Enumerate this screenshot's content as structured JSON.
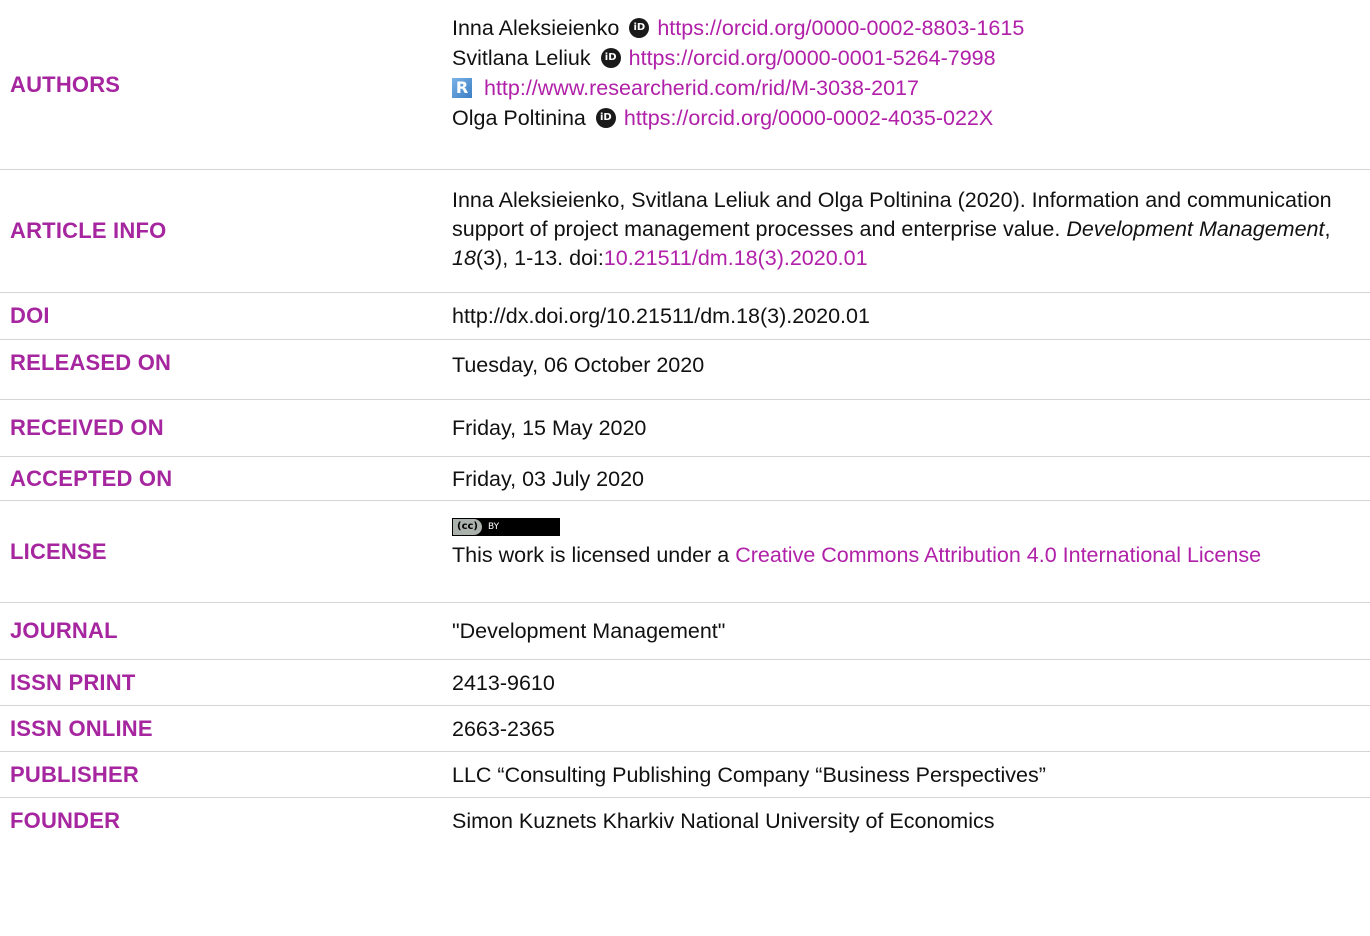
{
  "authors": {
    "label": "AUTHORS",
    "lines": [
      {
        "name": "Inna Aleksieienko",
        "link": "https://orcid.org/0000-0002-8803-1615"
      },
      {
        "name": "Svitlana Leliuk",
        "link": "https://orcid.org/0000-0001-5264-7998"
      },
      {
        "name": "",
        "link": "http://www.researcherid.com/rid/M-3038-2017"
      },
      {
        "name": "Olga Poltinina",
        "link": "https://orcid.org/0000-0002-4035-022X"
      }
    ]
  },
  "article_info": {
    "label": "ARTICLE INFO",
    "text1": "Inna Aleksieienko, Svitlana Leliuk and Olga Poltinina (2020). Information and communication support of project management processes and enterprise value.",
    "journal": "Development Management",
    "sep1": ", ",
    "volume": "18",
    "issue_pages": "(3), 1-13. doi:",
    "doi_link": "10.21511/dm.18(3).2020.01"
  },
  "doi": {
    "label": "DOI",
    "value": "http://dx.doi.org/10.21511/dm.18(3).2020.01"
  },
  "released_on": {
    "label": "RELEASED ON",
    "value": "Tuesday, 06 October 2020"
  },
  "received_on": {
    "label": "RECEIVED ON",
    "value": "Friday, 15 May 2020"
  },
  "accepted_on": {
    "label": "ACCEPTED ON",
    "value": "Friday, 03 July 2020"
  },
  "license": {
    "label": "LICENSE",
    "badge_cc": "(cc)",
    "badge_by": "BY",
    "text": "This work is licensed under a ",
    "link": "Creative Commons Attribution 4.0 International License"
  },
  "journal": {
    "label": "JOURNAL",
    "value": "\"Development Management\""
  },
  "issn_print": {
    "label": "ISSN PRINT",
    "value": "2413-9610"
  },
  "issn_online": {
    "label": "ISSN ONLINE",
    "value": "2663-2365"
  },
  "publisher": {
    "label": "PUBLISHER",
    "value": "LLC “Consulting Publishing Company “Business Perspectives”"
  },
  "founder": {
    "label": "FOUNDER",
    "value": "Simon Kuznets Kharkiv National University of Economics"
  },
  "colors": {
    "label": "#a6269f",
    "link": "#b020a8"
  }
}
